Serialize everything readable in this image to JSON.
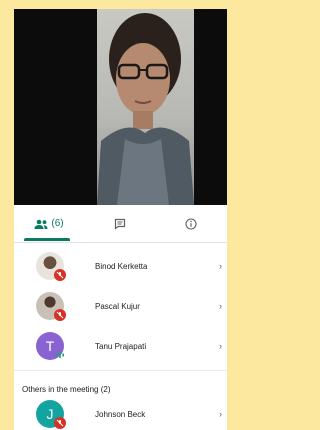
{
  "video": {
    "background_color": "#0c0c0c"
  },
  "tabs": {
    "people_count": "(6)",
    "active_color": "#0b7a63"
  },
  "participants": [
    {
      "name": "Binod Kerketta",
      "avatar_type": "photo",
      "status": "mic-off"
    },
    {
      "name": "Pascal Kujur",
      "avatar_type": "photo",
      "status": "mic-off"
    },
    {
      "name": "Tanu Prajapati",
      "avatar_type": "letter",
      "avatar_letter": "T",
      "avatar_color": "#8a63d2",
      "status": "speaking"
    }
  ],
  "others": {
    "header": "Others in the meeting (2)",
    "participants": [
      {
        "name": "Johnson Beck",
        "avatar_type": "letter",
        "avatar_letter": "J",
        "avatar_color": "#12a4a0",
        "status": "mic-off"
      }
    ]
  },
  "chevron": "›"
}
